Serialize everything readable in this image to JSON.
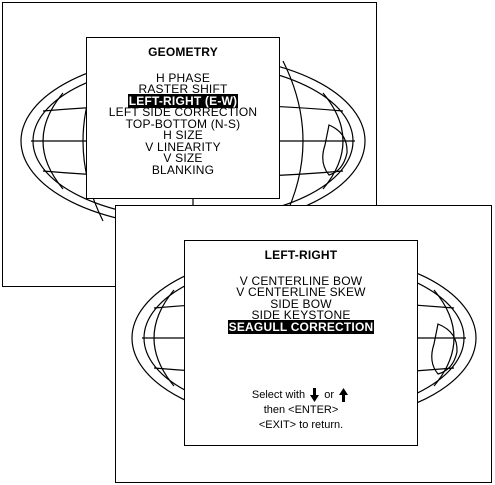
{
  "geometry_menu": {
    "title": "GEOMETRY",
    "items": [
      {
        "label": "H PHASE",
        "selected": false
      },
      {
        "label": "RASTER SHIFT",
        "selected": false
      },
      {
        "label": "LEFT-RIGHT (E-W)",
        "selected": true
      },
      {
        "label": "LEFT SIDE CORRECTION",
        "selected": false
      },
      {
        "label": "TOP-BOTTOM (N-S)",
        "selected": false
      },
      {
        "label": "H SIZE",
        "selected": false
      },
      {
        "label": "V LINEARITY",
        "selected": false
      },
      {
        "label": "V SIZE",
        "selected": false
      },
      {
        "label": "BLANKING",
        "selected": false
      }
    ]
  },
  "leftright_menu": {
    "title": "LEFT-RIGHT",
    "items": [
      {
        "label": "V CENTERLINE BOW",
        "selected": false
      },
      {
        "label": "V CENTERLINE SKEW",
        "selected": false
      },
      {
        "label": "SIDE BOW",
        "selected": false
      },
      {
        "label": "SIDE KEYSTONE",
        "selected": false
      },
      {
        "label": "SEAGULL CORRECTION",
        "selected": true
      }
    ],
    "help": {
      "select_prefix": "Select with",
      "or_text": "or",
      "enter_line": "then <ENTER>",
      "exit_line": "<EXIT> to return."
    }
  }
}
